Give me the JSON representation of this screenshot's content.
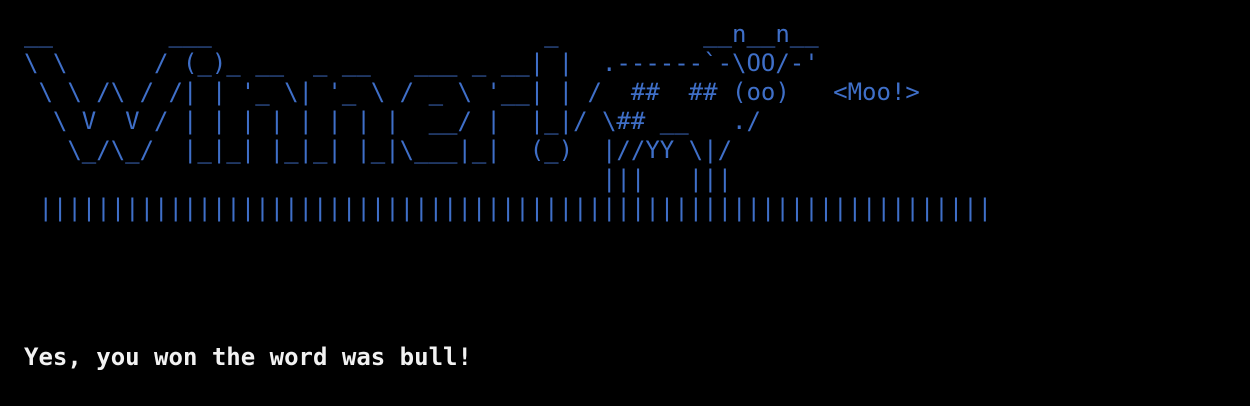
{
  "terminal": {
    "ascii_art": "__        ___                       _          __n__n__\n\\ \\      / (_)_ __  _ __   ___ _ __| |  .------`-\\OO/-'\n \\ \\ /\\ / /| | '_ \\| '_ \\ / _ \\ '__| | /  ##  ## (oo)   <Moo!>\n  \\ V  V / | | | | | | | |  __/ |  |_|/ \\## __   ./\n   \\_/\\_/  |_|_| |_|_| |_|\\___|_|  (_)  |//YY \\|/\n                                        |||   |||\n ||||||||||||||||||||||||||||||||||||||||||||||||||||||||||||||||||",
    "message": "Yes, you won the word was bull!",
    "colors": {
      "background": "#000000",
      "art": "#3f6fc8",
      "text": "#f2f2f2"
    }
  }
}
